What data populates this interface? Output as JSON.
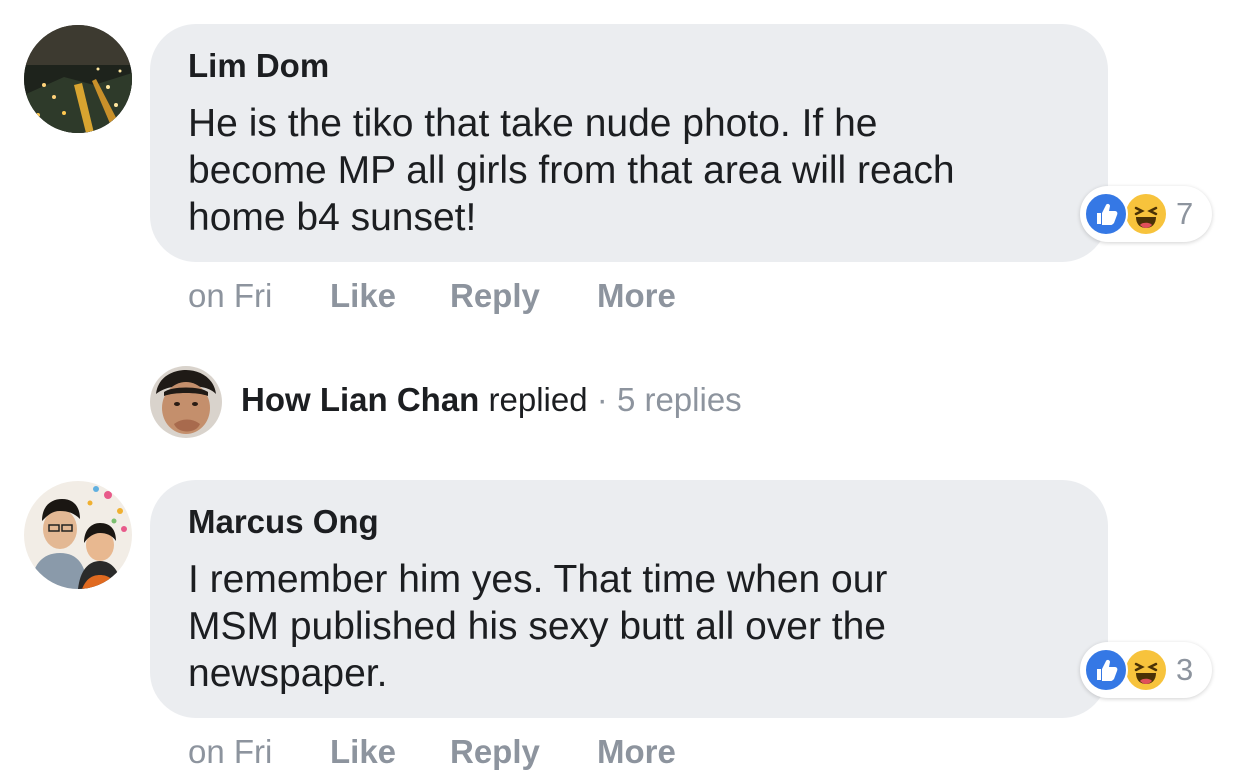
{
  "comments": [
    {
      "author": "Lim Dom",
      "lines": [
        "He is the tiko that take nude photo. If he",
        "become MP all girls from that area will reach",
        "home b4 sunset!"
      ],
      "reactions": {
        "icons": [
          "like-icon",
          "haha-icon"
        ],
        "count": "7"
      },
      "time": "on Fri",
      "actions": {
        "like": "Like",
        "reply": "Reply",
        "more": "More"
      }
    },
    {
      "author": "Marcus Ong",
      "lines": [
        "I remember him yes. That time when our",
        "MSM published his sexy butt all over the",
        "newspaper."
      ],
      "reactions": {
        "icons": [
          "like-icon",
          "haha-icon"
        ],
        "count": "3"
      },
      "time": "on Fri",
      "actions": {
        "like": "Like",
        "reply": "Reply",
        "more": "More"
      }
    }
  ],
  "reply_thread": {
    "name": "How Lian Chan",
    "verb": "replied",
    "separator": "·",
    "count_text": "5 replies"
  },
  "colors": {
    "bubble": "#ebedf0",
    "text": "#1c1e21",
    "muted": "#8d949e",
    "like_blue": "#3578e5",
    "haha_yellow": "#f7c33c"
  }
}
